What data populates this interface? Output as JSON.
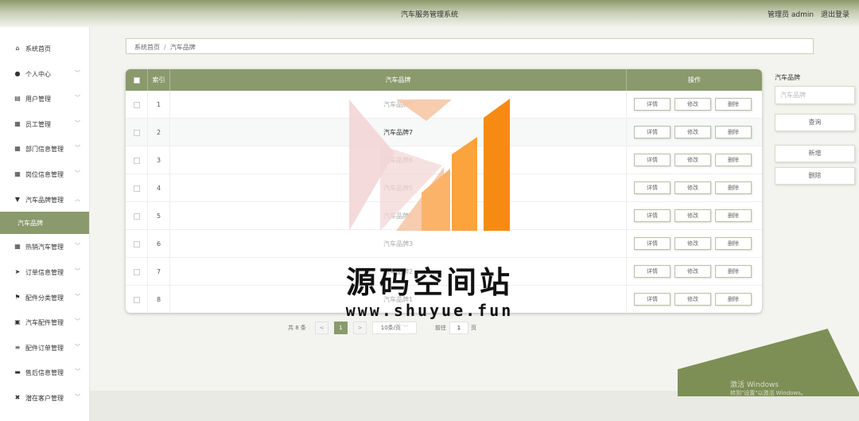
{
  "header": {
    "title": "汽车服务管理系统",
    "user": "管理员 admin",
    "logout": "退出登录"
  },
  "sidebar": {
    "items": [
      {
        "label": "系统首页",
        "icon": "home-icon",
        "glyph": "⌂"
      },
      {
        "label": "个人中心",
        "icon": "user-icon",
        "glyph": "●"
      },
      {
        "label": "用户管理",
        "icon": "clipboard-icon",
        "glyph": "▤"
      },
      {
        "label": "员工管理",
        "icon": "grid-icon",
        "glyph": "▦"
      },
      {
        "label": "部门信息管理",
        "icon": "grid-icon",
        "glyph": "▦"
      },
      {
        "label": "岗位信息管理",
        "icon": "grid-icon",
        "glyph": "▦"
      },
      {
        "label": "汽车品牌管理",
        "icon": "shield-icon",
        "glyph": "▼"
      },
      {
        "label": "热销汽车管理",
        "icon": "grid-icon",
        "glyph": "▦"
      },
      {
        "label": "订单信息管理",
        "icon": "send-icon",
        "glyph": "➤"
      },
      {
        "label": "配件分类管理",
        "icon": "flag-icon",
        "glyph": "⚑"
      },
      {
        "label": "汽车配件管理",
        "icon": "chart-icon",
        "glyph": "▣"
      },
      {
        "label": "配件订单管理",
        "icon": "list-icon",
        "glyph": "≡"
      },
      {
        "label": "售后信息管理",
        "icon": "chat-icon",
        "glyph": "▬"
      },
      {
        "label": "潜在客户管理",
        "icon": "users-icon",
        "glyph": "✖"
      }
    ],
    "active_sub": "汽车品牌"
  },
  "breadcrumb": {
    "home": "系统首页",
    "sep": "/",
    "current": "汽车品牌"
  },
  "table": {
    "headers": {
      "index": "索引",
      "brand": "汽车品牌",
      "ops": "操作"
    },
    "rows": [
      {
        "index": "1",
        "brand": "汽车品牌8"
      },
      {
        "index": "2",
        "brand": "汽车品牌7"
      },
      {
        "index": "3",
        "brand": "汽车品牌6"
      },
      {
        "index": "4",
        "brand": "汽车品牌5"
      },
      {
        "index": "5",
        "brand": "汽车品牌4"
      },
      {
        "index": "6",
        "brand": "汽车品牌3"
      },
      {
        "index": "7",
        "brand": "汽车品牌2"
      },
      {
        "index": "8",
        "brand": "汽车品牌1"
      }
    ],
    "buttons": {
      "detail": "详情",
      "edit": "修改",
      "delete": "删除"
    }
  },
  "pagination": {
    "total": "共 8 条",
    "prev": "<",
    "page": "1",
    "next": ">",
    "size": "10条/页",
    "goto_prefix": "前往",
    "goto_value": "1",
    "goto_suffix": "页"
  },
  "right_panel": {
    "label": "汽车品牌",
    "placeholder": "汽车品牌",
    "query": "查询",
    "add": "新增",
    "delete": "删除"
  },
  "watermark": {
    "title": "源码空间站",
    "url": "www.shuyue.fun"
  },
  "system_watermark": {
    "line1": "激活 Windows",
    "line2": "转到\"设置\"以激活 Windows。"
  },
  "colors": {
    "accent": "#8a9a6c",
    "shape": "#7d8f55",
    "logo_orange": "#f78a12",
    "logo_peach": "#f6c7a6",
    "logo_pink": "#f2d4d4"
  }
}
